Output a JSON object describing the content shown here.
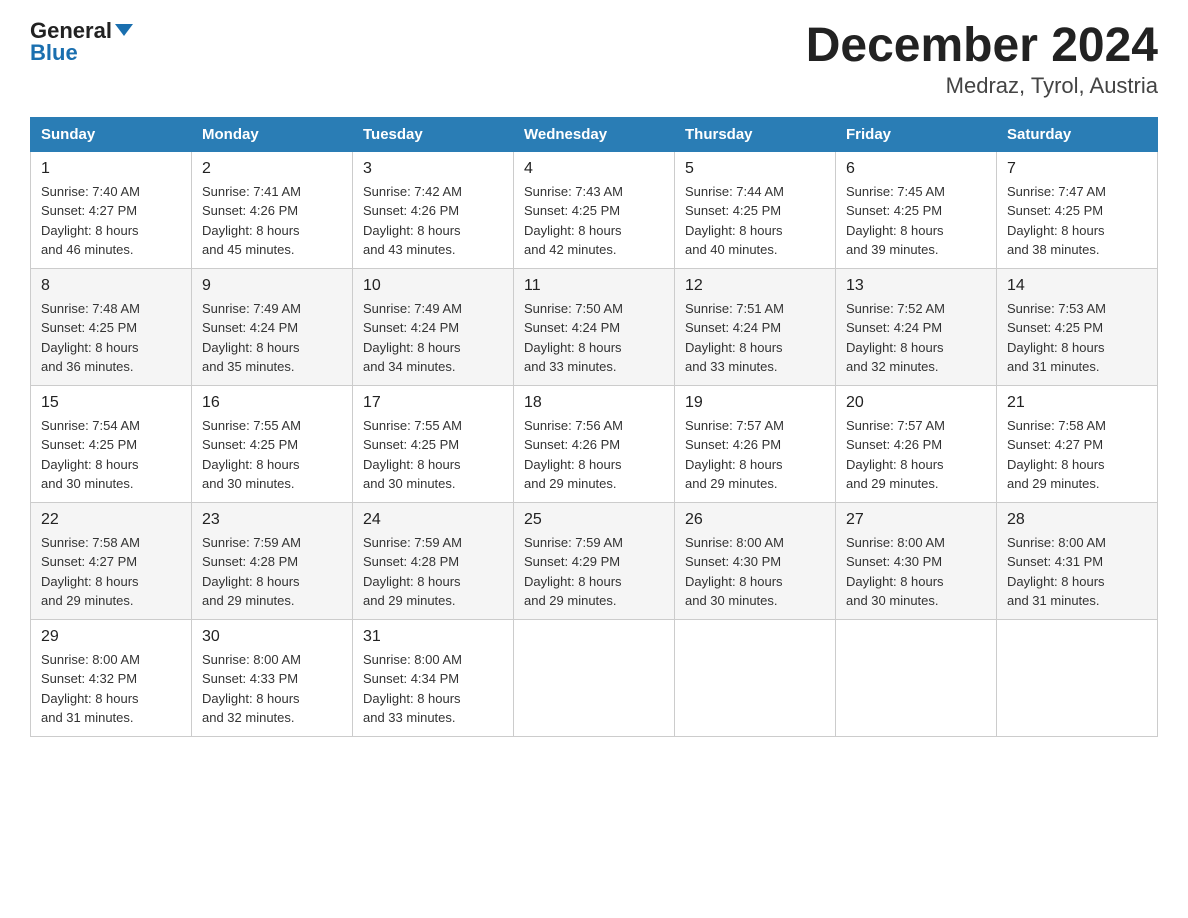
{
  "header": {
    "logo_line1": "General",
    "logo_line2": "Blue",
    "title": "December 2024",
    "subtitle": "Medraz, Tyrol, Austria"
  },
  "weekdays": [
    "Sunday",
    "Monday",
    "Tuesday",
    "Wednesday",
    "Thursday",
    "Friday",
    "Saturday"
  ],
  "weeks": [
    [
      {
        "day": "1",
        "sunrise": "7:40 AM",
        "sunset": "4:27 PM",
        "daylight": "8 hours and 46 minutes."
      },
      {
        "day": "2",
        "sunrise": "7:41 AM",
        "sunset": "4:26 PM",
        "daylight": "8 hours and 45 minutes."
      },
      {
        "day": "3",
        "sunrise": "7:42 AM",
        "sunset": "4:26 PM",
        "daylight": "8 hours and 43 minutes."
      },
      {
        "day": "4",
        "sunrise": "7:43 AM",
        "sunset": "4:25 PM",
        "daylight": "8 hours and 42 minutes."
      },
      {
        "day": "5",
        "sunrise": "7:44 AM",
        "sunset": "4:25 PM",
        "daylight": "8 hours and 40 minutes."
      },
      {
        "day": "6",
        "sunrise": "7:45 AM",
        "sunset": "4:25 PM",
        "daylight": "8 hours and 39 minutes."
      },
      {
        "day": "7",
        "sunrise": "7:47 AM",
        "sunset": "4:25 PM",
        "daylight": "8 hours and 38 minutes."
      }
    ],
    [
      {
        "day": "8",
        "sunrise": "7:48 AM",
        "sunset": "4:25 PM",
        "daylight": "8 hours and 36 minutes."
      },
      {
        "day": "9",
        "sunrise": "7:49 AM",
        "sunset": "4:24 PM",
        "daylight": "8 hours and 35 minutes."
      },
      {
        "day": "10",
        "sunrise": "7:49 AM",
        "sunset": "4:24 PM",
        "daylight": "8 hours and 34 minutes."
      },
      {
        "day": "11",
        "sunrise": "7:50 AM",
        "sunset": "4:24 PM",
        "daylight": "8 hours and 33 minutes."
      },
      {
        "day": "12",
        "sunrise": "7:51 AM",
        "sunset": "4:24 PM",
        "daylight": "8 hours and 33 minutes."
      },
      {
        "day": "13",
        "sunrise": "7:52 AM",
        "sunset": "4:24 PM",
        "daylight": "8 hours and 32 minutes."
      },
      {
        "day": "14",
        "sunrise": "7:53 AM",
        "sunset": "4:25 PM",
        "daylight": "8 hours and 31 minutes."
      }
    ],
    [
      {
        "day": "15",
        "sunrise": "7:54 AM",
        "sunset": "4:25 PM",
        "daylight": "8 hours and 30 minutes."
      },
      {
        "day": "16",
        "sunrise": "7:55 AM",
        "sunset": "4:25 PM",
        "daylight": "8 hours and 30 minutes."
      },
      {
        "day": "17",
        "sunrise": "7:55 AM",
        "sunset": "4:25 PM",
        "daylight": "8 hours and 30 minutes."
      },
      {
        "day": "18",
        "sunrise": "7:56 AM",
        "sunset": "4:26 PM",
        "daylight": "8 hours and 29 minutes."
      },
      {
        "day": "19",
        "sunrise": "7:57 AM",
        "sunset": "4:26 PM",
        "daylight": "8 hours and 29 minutes."
      },
      {
        "day": "20",
        "sunrise": "7:57 AM",
        "sunset": "4:26 PM",
        "daylight": "8 hours and 29 minutes."
      },
      {
        "day": "21",
        "sunrise": "7:58 AM",
        "sunset": "4:27 PM",
        "daylight": "8 hours and 29 minutes."
      }
    ],
    [
      {
        "day": "22",
        "sunrise": "7:58 AM",
        "sunset": "4:27 PM",
        "daylight": "8 hours and 29 minutes."
      },
      {
        "day": "23",
        "sunrise": "7:59 AM",
        "sunset": "4:28 PM",
        "daylight": "8 hours and 29 minutes."
      },
      {
        "day": "24",
        "sunrise": "7:59 AM",
        "sunset": "4:28 PM",
        "daylight": "8 hours and 29 minutes."
      },
      {
        "day": "25",
        "sunrise": "7:59 AM",
        "sunset": "4:29 PM",
        "daylight": "8 hours and 29 minutes."
      },
      {
        "day": "26",
        "sunrise": "8:00 AM",
        "sunset": "4:30 PM",
        "daylight": "8 hours and 30 minutes."
      },
      {
        "day": "27",
        "sunrise": "8:00 AM",
        "sunset": "4:30 PM",
        "daylight": "8 hours and 30 minutes."
      },
      {
        "day": "28",
        "sunrise": "8:00 AM",
        "sunset": "4:31 PM",
        "daylight": "8 hours and 31 minutes."
      }
    ],
    [
      {
        "day": "29",
        "sunrise": "8:00 AM",
        "sunset": "4:32 PM",
        "daylight": "8 hours and 31 minutes."
      },
      {
        "day": "30",
        "sunrise": "8:00 AM",
        "sunset": "4:33 PM",
        "daylight": "8 hours and 32 minutes."
      },
      {
        "day": "31",
        "sunrise": "8:00 AM",
        "sunset": "4:34 PM",
        "daylight": "8 hours and 33 minutes."
      },
      null,
      null,
      null,
      null
    ]
  ],
  "labels": {
    "sunrise": "Sunrise:",
    "sunset": "Sunset:",
    "daylight": "Daylight:"
  }
}
